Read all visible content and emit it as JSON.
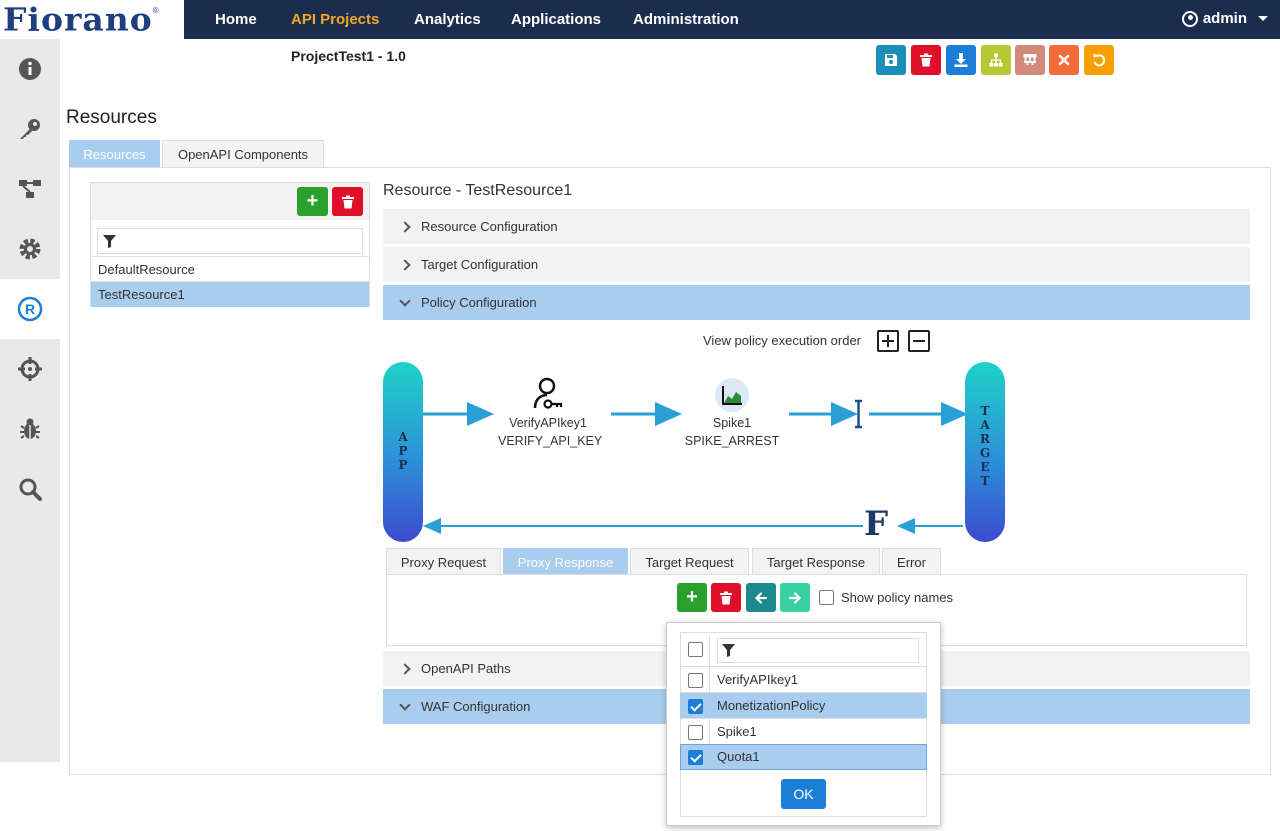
{
  "brand": {
    "logo_text": "Fiorano",
    "logo_mark": "®"
  },
  "nav": {
    "items": [
      {
        "label": "Home"
      },
      {
        "label": "API Projects",
        "active": true
      },
      {
        "label": "Analytics"
      },
      {
        "label": "Applications"
      },
      {
        "label": "Administration"
      }
    ],
    "user": "admin"
  },
  "sidebar": {
    "items": [
      {
        "icon": "info-icon"
      },
      {
        "icon": "key-icon"
      },
      {
        "icon": "flow-icon"
      },
      {
        "icon": "gear-icon"
      },
      {
        "icon": "registered-icon",
        "active": true
      },
      {
        "icon": "crosshair-icon"
      },
      {
        "icon": "bug-icon"
      },
      {
        "icon": "search-icon"
      }
    ]
  },
  "project": {
    "title": "ProjectTest1 - 1.0"
  },
  "toolbar": {
    "buttons": [
      {
        "icon": "save-icon",
        "color": "#1c8fb8"
      },
      {
        "icon": "trash-icon",
        "color": "#e0102a"
      },
      {
        "icon": "download-icon",
        "color": "#1c7ed6"
      },
      {
        "icon": "hierarchy-icon",
        "color": "#b8c832"
      },
      {
        "icon": "deploy-icon",
        "color": "#d48a7a"
      },
      {
        "icon": "close-icon",
        "color": "#f26b3a"
      },
      {
        "icon": "undo-icon",
        "color": "#f5a000"
      }
    ]
  },
  "resources": {
    "title": "Resources",
    "tabs": [
      {
        "label": "Resources",
        "active": true
      },
      {
        "label": "OpenAPI Components"
      }
    ],
    "list": [
      "DefaultResource",
      "TestResource1"
    ],
    "selected": "TestResource1"
  },
  "detail": {
    "title": "Resource - TestResource1",
    "sections": [
      {
        "label": "Resource Configuration",
        "open": false
      },
      {
        "label": "Target Configuration",
        "open": false
      },
      {
        "label": "Policy Configuration",
        "open": true
      },
      {
        "label": "OpenAPI Paths",
        "open": false
      },
      {
        "label": "WAF Configuration",
        "open": true
      }
    ],
    "view_order_label": "View policy execution order"
  },
  "flow": {
    "app_label": "APP",
    "target_label": "TARGET",
    "policies": [
      {
        "name": "VerifyAPIkey1",
        "type": "VERIFY_API_KEY",
        "icon": "user-key-icon"
      },
      {
        "name": "Spike1",
        "type": "SPIKE_ARREST",
        "icon": "chart-icon"
      }
    ],
    "response_logo": "F"
  },
  "policy_tabs": [
    {
      "label": "Proxy Request"
    },
    {
      "label": "Proxy Response",
      "active": true
    },
    {
      "label": "Target Request"
    },
    {
      "label": "Target Response"
    },
    {
      "label": "Error"
    }
  ],
  "policy_actions": {
    "show_names_label": "Show policy names"
  },
  "popup": {
    "items": [
      {
        "name": "VerifyAPIkey1",
        "checked": false
      },
      {
        "name": "MonetizationPolicy",
        "checked": true
      },
      {
        "name": "Spike1",
        "checked": false
      },
      {
        "name": "Quota1",
        "checked": true
      }
    ],
    "ok_label": "OK"
  }
}
